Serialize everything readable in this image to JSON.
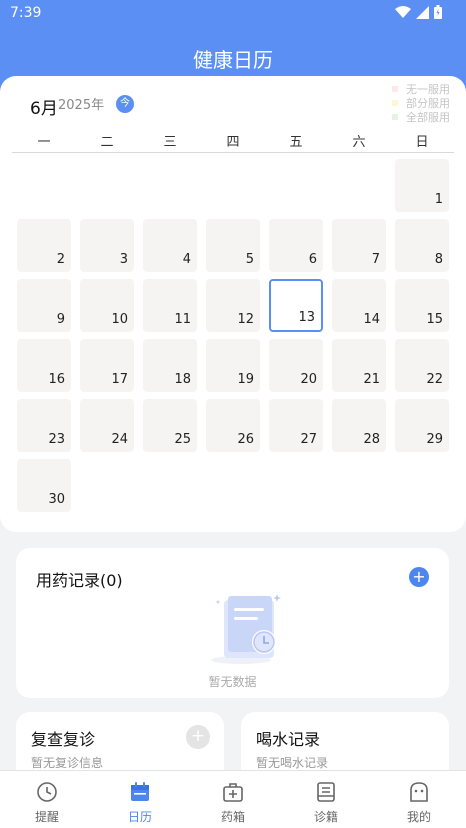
{
  "status_bar": {
    "time": "7:39"
  },
  "header": {
    "title": "健康日历"
  },
  "calendar": {
    "month": "6月",
    "year": "2025年",
    "today_label": "今",
    "legend": [
      {
        "label": "无一服用",
        "color": "#fde8ea"
      },
      {
        "label": "部分服用",
        "color": "#fdf6d7"
      },
      {
        "label": "全部服用",
        "color": "#e3f5e0"
      }
    ],
    "weekdays": [
      "一",
      "二",
      "三",
      "四",
      "五",
      "六",
      "日"
    ],
    "days": [
      "1",
      "2",
      "3",
      "4",
      "5",
      "6",
      "7",
      "8",
      "9",
      "10",
      "11",
      "12",
      "13",
      "14",
      "15",
      "16",
      "17",
      "18",
      "19",
      "20",
      "21",
      "22",
      "23",
      "24",
      "25",
      "26",
      "27",
      "28",
      "29",
      "30"
    ],
    "selected_day": "13"
  },
  "medication": {
    "title": "用药记录(0)",
    "add_label": "+",
    "empty_text": "暂无数据"
  },
  "followup": {
    "title": "复查复诊",
    "subtitle": "暂无复诊信息",
    "add_label": "+"
  },
  "water": {
    "title": "喝水记录",
    "subtitle": "暂无喝水记录"
  },
  "nav": [
    {
      "label": "提醒",
      "icon": "clock-icon",
      "active": false
    },
    {
      "label": "日历",
      "icon": "calendar-icon",
      "active": true
    },
    {
      "label": "药箱",
      "icon": "medicine-box-icon",
      "active": false
    },
    {
      "label": "诊籍",
      "icon": "records-icon",
      "active": false
    },
    {
      "label": "我的",
      "icon": "profile-icon",
      "active": false
    }
  ],
  "colors": {
    "brand": "#5b8ff4",
    "accent": "#4e86f0",
    "day_cell": "#f5f4f3"
  }
}
